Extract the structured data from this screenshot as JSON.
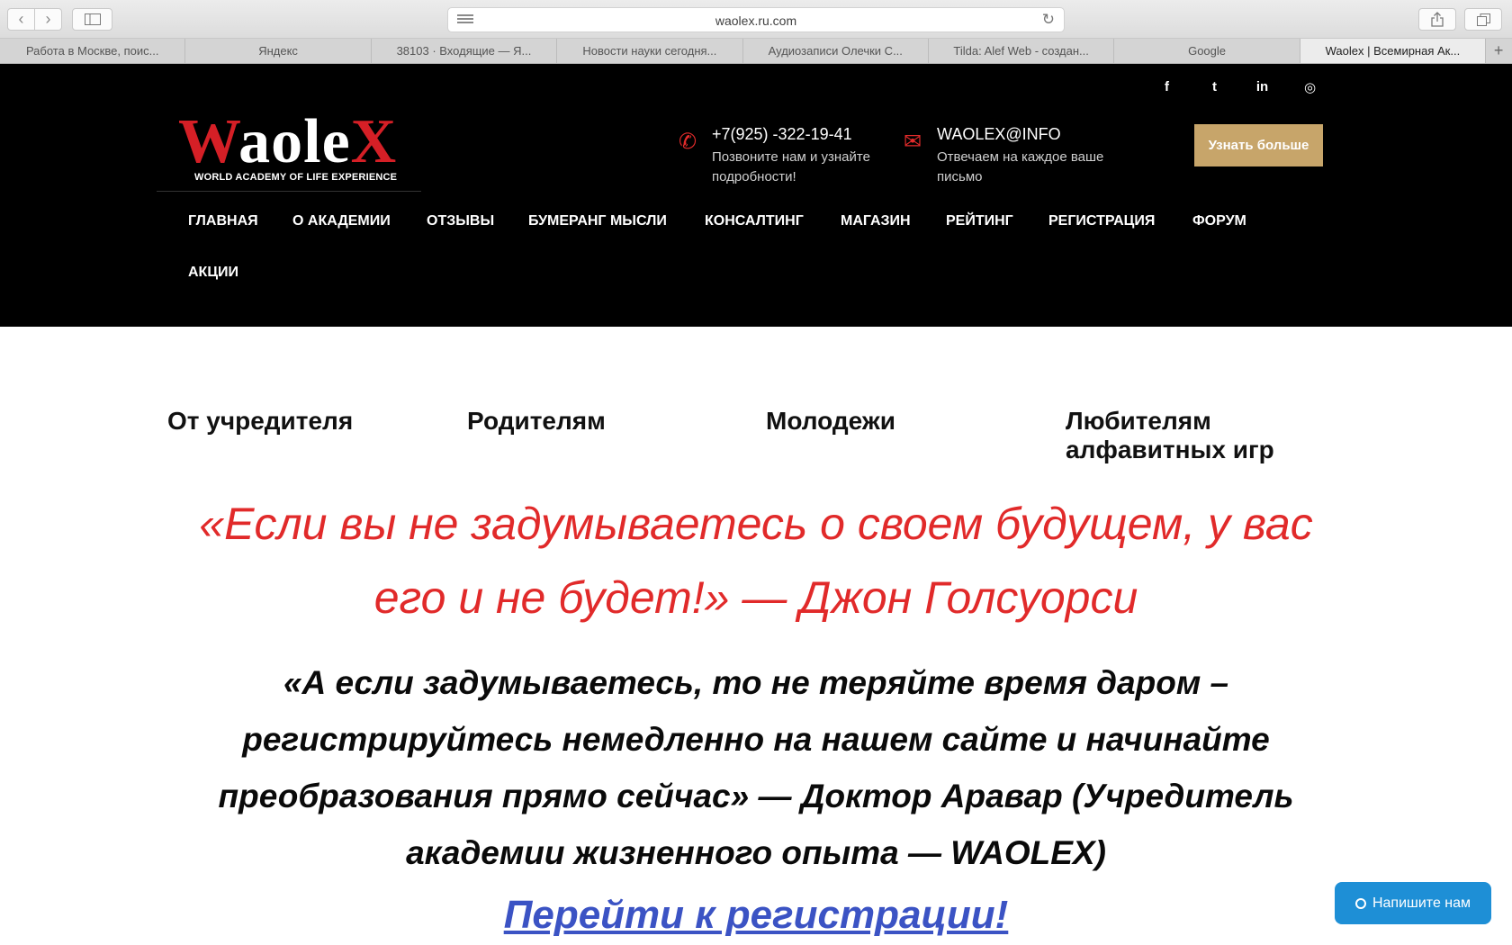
{
  "browser": {
    "url": "waolex.ru.com",
    "tabs": [
      {
        "label": "Работа в Москве, поис...",
        "active": false
      },
      {
        "label": "Яндекс",
        "active": false
      },
      {
        "label": "38103 · Входящие — Я...",
        "active": false
      },
      {
        "label": "Новости науки сегодня...",
        "active": false
      },
      {
        "label": "Аудиозаписи Олечки С...",
        "active": false
      },
      {
        "label": "Tilda: Alef Web - создан...",
        "active": false
      },
      {
        "label": "Google",
        "active": false
      },
      {
        "label": "Waolex | Всемирная Ак...",
        "active": true
      }
    ]
  },
  "header": {
    "logo_text": "WaoleX",
    "logo_tagline": "WORLD ACADEMY OF LIFE EXPERIENCE",
    "social": [
      "f",
      "t",
      "in",
      "◎"
    ],
    "phone": {
      "number": "+7(925) -322-19-41",
      "sub": "Позвоните нам и узнайте подробности!"
    },
    "email": {
      "address": "WAOLEX@INFO",
      "sub": "Отвечаем на каждое ваше письмо"
    },
    "cta_label": "Узнать больше",
    "nav": [
      "ГЛАВНАЯ",
      "О АКАДЕМИИ",
      "ОТЗЫВЫ",
      "БУМЕРАНГ МЫСЛИ",
      "КОНСАЛТИНГ",
      "МАГАЗИН",
      "РЕЙТИНГ",
      "РЕГИСТРАЦИЯ",
      "ФОРУМ",
      "АКЦИИ"
    ]
  },
  "categories": [
    "От учредителя",
    "Родителям",
    "Молодежи",
    "Любителям алфавитных игр"
  ],
  "quote_red": "«Если вы не задумываетесь о своем будущем, у вас его и не будет!» — Джон Голсуорси",
  "quote_black": "«А если  задумываетесь, то не теряйте время даром – регистрируйтесь немедленно на нашем сайте и начинайте преобразования прямо сейчас» — Доктор Аравар (Учредитель академии жизненного опыта — WAOLEX)",
  "register_link": "Перейти к регистрации!",
  "chat_label": "Напишите нам",
  "colors": {
    "accent_red": "#e12a2a",
    "cta_gold": "#c7a56a",
    "link_blue": "#3b53c4",
    "chat_blue": "#1e8fd6"
  }
}
